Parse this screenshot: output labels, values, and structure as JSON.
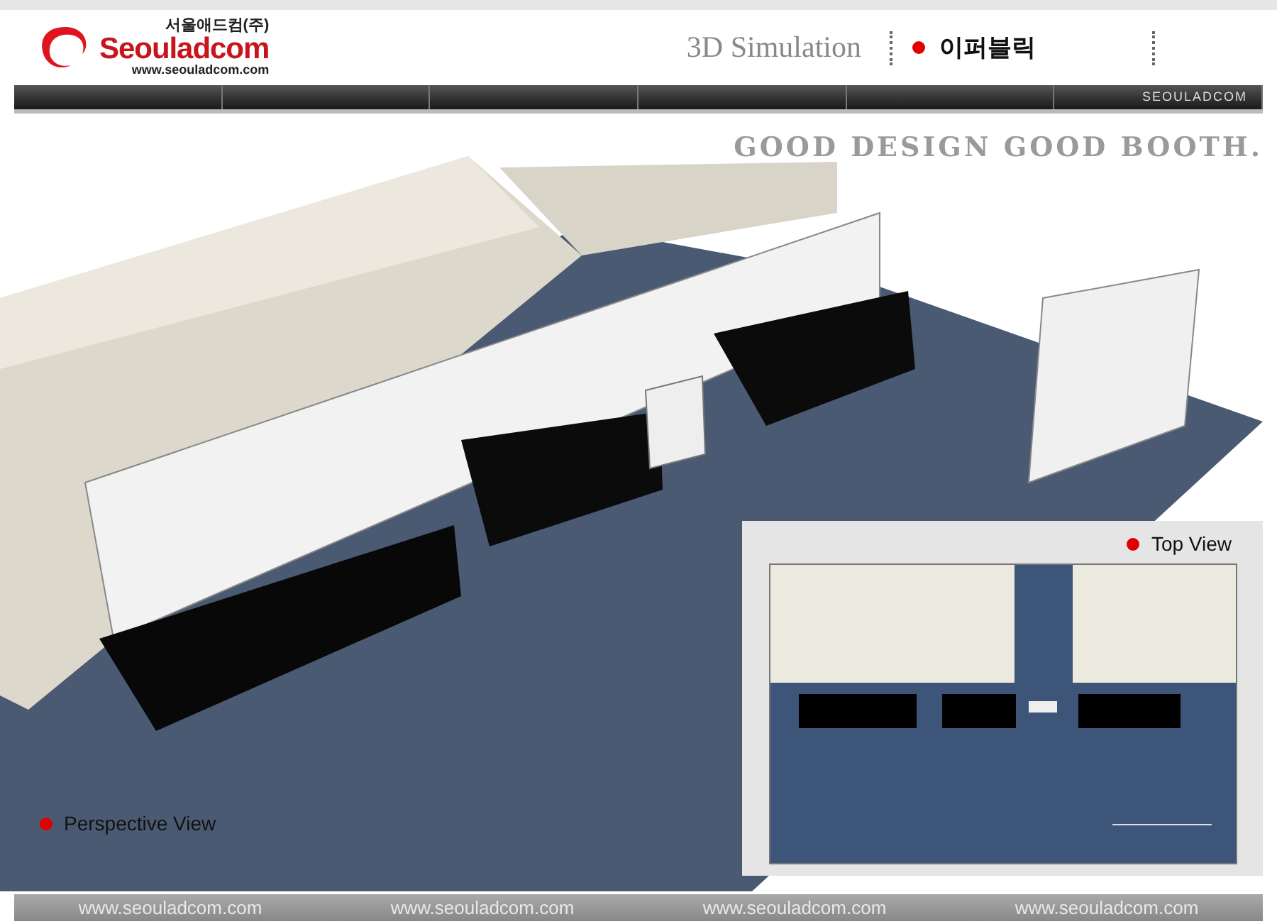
{
  "logo": {
    "name": "Seouladcom",
    "korean_name": "서울애드컴(주)",
    "url": "www.seouladcom.com"
  },
  "header": {
    "title": "3D Simulation",
    "client": "이퍼블릭"
  },
  "nav": {
    "label": "SEOULADCOM"
  },
  "tagline": "GOOD DESIGN GOOD BOOTH.",
  "perspective_view": {
    "label": "Perspective View"
  },
  "top_view": {
    "label": "Top View"
  },
  "footer": {
    "links": [
      "www.seouladcom.com",
      "www.seouladcom.com",
      "www.seouladcom.com",
      "www.seouladcom.com"
    ]
  }
}
